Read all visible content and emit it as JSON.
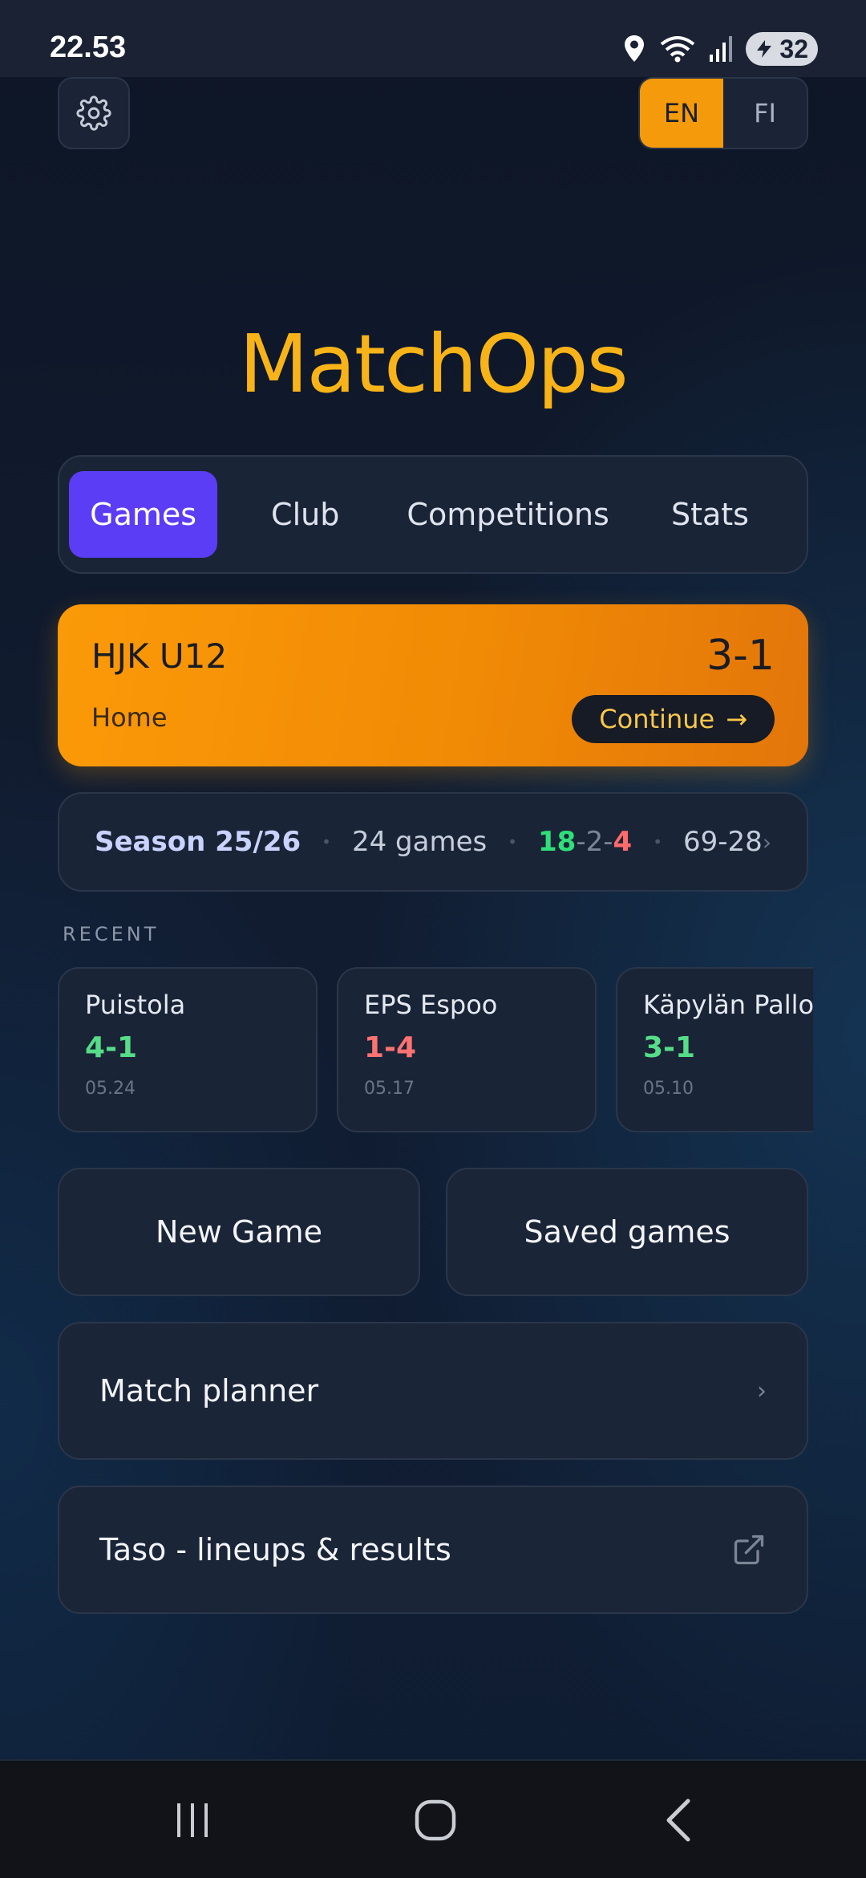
{
  "status_bar": {
    "time": "22.53",
    "battery": "32",
    "icons": [
      "location-icon",
      "wifi-icon",
      "signal-icon",
      "battery-icon"
    ]
  },
  "header": {
    "settings_icon": "gear-icon",
    "languages": [
      {
        "label": "EN",
        "active": true
      },
      {
        "label": "FI",
        "active": false
      }
    ]
  },
  "app": {
    "title": "MatchOps"
  },
  "tabs": [
    {
      "label": "Games",
      "active": true
    },
    {
      "label": "Club",
      "active": false
    },
    {
      "label": "Competitions",
      "active": false
    },
    {
      "label": "Stats",
      "active": false
    }
  ],
  "current_game": {
    "team": "HJK U12",
    "score": "3-1",
    "venue": "Home",
    "continue_label": "Continue",
    "continue_arrow": "→"
  },
  "season": {
    "name": "Season 25/26",
    "games": "24 games",
    "wins": "18",
    "draws": "2",
    "losses": "4",
    "goals": "69-28",
    "chevron": "›"
  },
  "recent": {
    "label": "RECENT",
    "items": [
      {
        "opponent": "Puistola",
        "result": "4-1",
        "outcome": "win",
        "date": "05.24"
      },
      {
        "opponent": "EPS Espoo",
        "result": "1-4",
        "outcome": "loss",
        "date": "05.17"
      },
      {
        "opponent": "Käpylän Pallo",
        "result": "3-1",
        "outcome": "win",
        "date": "05.10"
      }
    ]
  },
  "actions": {
    "new_game": "New Game",
    "saved_games": "Saved games",
    "match_planner": "Match planner",
    "match_planner_chevron": "›",
    "taso": "Taso - lineups & results",
    "taso_icon": "external-link-icon"
  },
  "colors": {
    "accent_orange": "#f59a0a",
    "title_yellow": "#f7b318",
    "tab_active": "#5b3df5",
    "win_green": "#2ee07a",
    "loss_red": "#ff6a6a"
  },
  "nav": {
    "icons": [
      "recent-apps-icon",
      "home-icon",
      "back-icon"
    ]
  }
}
